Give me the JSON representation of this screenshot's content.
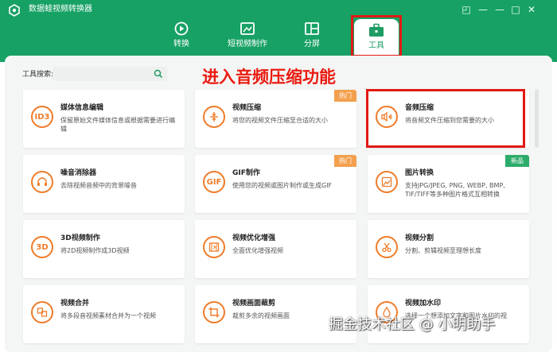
{
  "app": {
    "title": "数据蛙视频转换器"
  },
  "window_controls": [
    "◰",
    "—",
    "—",
    "□",
    "✕"
  ],
  "nav": {
    "tabs": [
      {
        "label": "转换",
        "icon": "convert-icon"
      },
      {
        "label": "短视频制作",
        "icon": "short-video-icon"
      },
      {
        "label": "分屏",
        "icon": "split-screen-icon"
      },
      {
        "label": "工具",
        "icon": "toolbox-icon",
        "active": true
      }
    ]
  },
  "search": {
    "label": "工具搜索:",
    "placeholder": ""
  },
  "annotation": "进入音频压缩功能",
  "badges": {
    "hot": "热门",
    "new": "新品"
  },
  "tools": [
    {
      "title": "媒体信息编辑",
      "desc": "保留原始文件媒体信息或根据需要进行编辑",
      "icon": "id3-icon",
      "icon_text": "ID3"
    },
    {
      "title": "视频压缩",
      "desc": "将您的视频文件压缩至合适的大小",
      "icon": "compress-icon",
      "badge": "hot"
    },
    {
      "title": "音频压缩",
      "desc": "将音频文件压缩到您需要的大小",
      "icon": "audio-compress-icon"
    },
    {
      "title": "噪音消除器",
      "desc": "去除视频音频中的背景噪音",
      "icon": "headphones-icon"
    },
    {
      "title": "GIF制作",
      "desc": "使用您的视频或图片制作或生成GIF",
      "icon": "gif-icon",
      "icon_text": "GIF",
      "badge": "hot"
    },
    {
      "title": "图片转换",
      "desc": "支持JPG/JPEG, PNG, WEBP, BMP, TIF/TIFF等多种图片格式互相转换",
      "icon": "image-convert-icon",
      "badge": "new"
    },
    {
      "title": "3D视频制作",
      "desc": "将2D视频制作成3D视频",
      "icon": "3d-icon",
      "icon_text": "3D"
    },
    {
      "title": "视频优化增强",
      "desc": "全面优化增强视频",
      "icon": "film-enhance-icon"
    },
    {
      "title": "视频分割",
      "desc": "分割、剪辑视频至理想长度",
      "icon": "scissors-icon"
    },
    {
      "title": "视频合并",
      "desc": "将多段音视频素材合并为一个视频",
      "icon": "merge-icon"
    },
    {
      "title": "视频画面裁剪",
      "desc": "裁剪多余的视频画面",
      "icon": "crop-icon"
    },
    {
      "title": "视频加水印",
      "desc": "选择一个想添加文字和图片水印的视",
      "icon": "watermark-drop-icon"
    }
  ],
  "watermark": "掘金技术社区 @ 小明助手",
  "colors": {
    "header": "#17a165",
    "accent": "#ef7b29",
    "highlight": "#e11a14",
    "hot": "#f3a04e",
    "new": "#2cac6a"
  }
}
